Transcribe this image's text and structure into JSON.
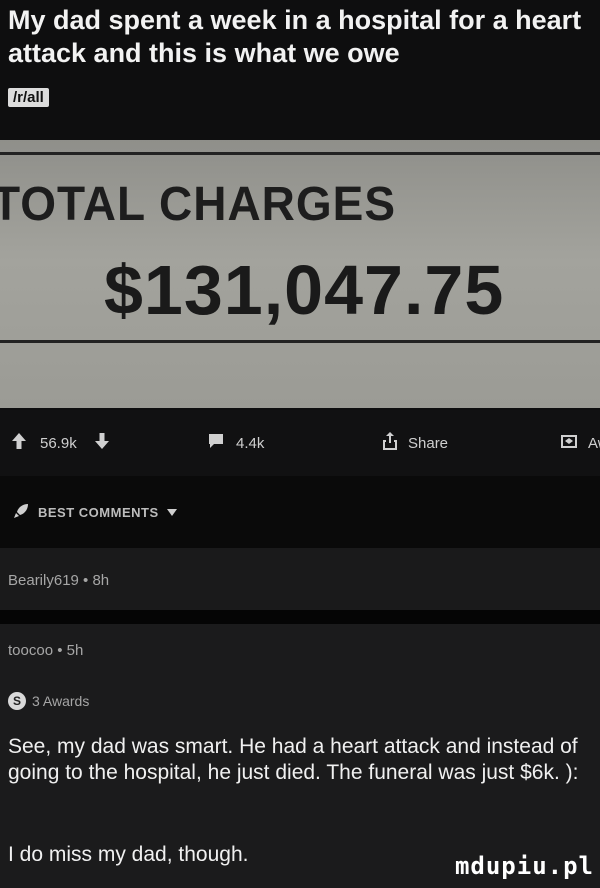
{
  "post": {
    "title": "My dad spent a week in a hospital for a heart attack and this is what we owe",
    "subreddit": "/r/all"
  },
  "photo": {
    "label": "TOTAL CHARGES",
    "amount": "$131,047.75"
  },
  "actions": {
    "upvotes": "56.9k",
    "comments": "4.4k",
    "share": "Share",
    "award": "Aw"
  },
  "comments_header": {
    "label": "BEST COMMENTS"
  },
  "comments": [
    {
      "meta": "Bearily619 • 8h"
    },
    {
      "meta": "toocoo • 5h",
      "awards": "3 Awards",
      "body": "See, my dad was smart. He had a heart attack and instead of going to the hospital, he just died. The funeral was just $6k. ):",
      "reply": "I do miss my dad, though."
    }
  ],
  "watermark": "mdupiu.pl"
}
